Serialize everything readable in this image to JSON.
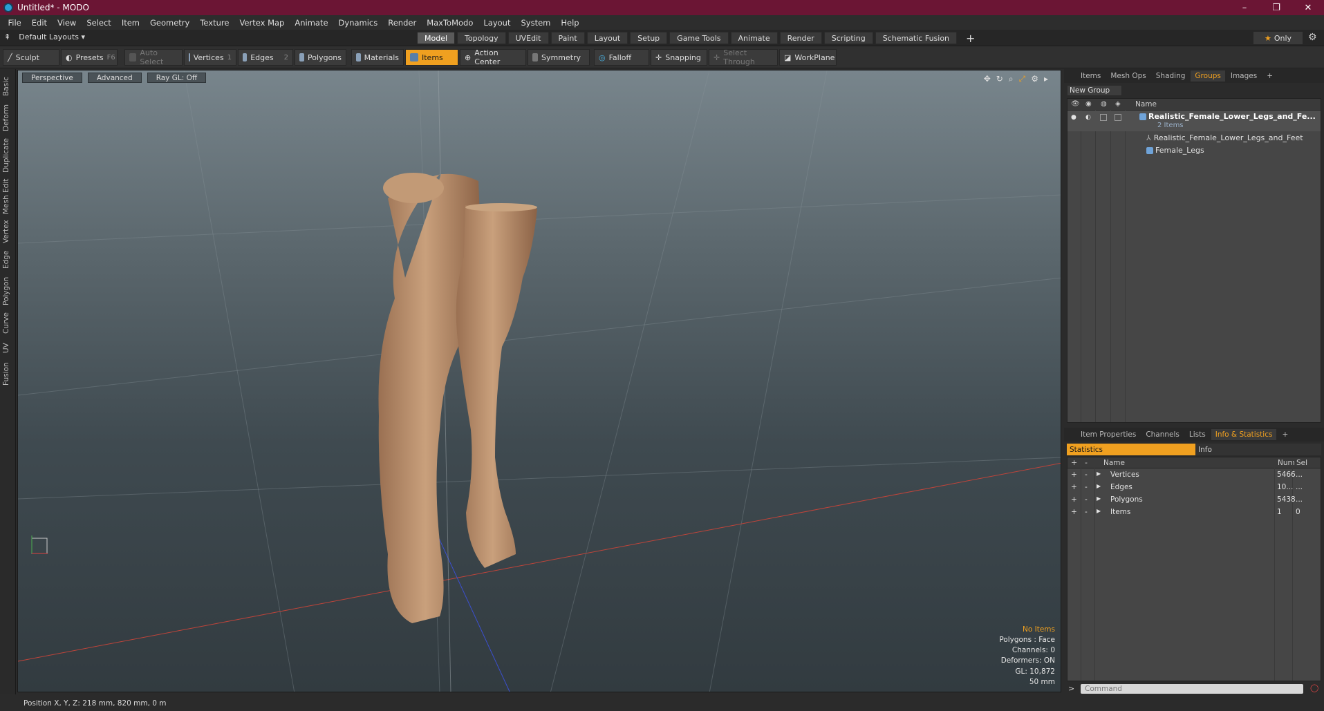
{
  "window": {
    "title": "Untitled* - MODO",
    "minimize": "–",
    "maximize": "❐",
    "close": "✕"
  },
  "menu": [
    "File",
    "Edit",
    "View",
    "Select",
    "Item",
    "Geometry",
    "Texture",
    "Vertex Map",
    "Animate",
    "Dynamics",
    "Render",
    "MaxToModo",
    "Layout",
    "System",
    "Help"
  ],
  "layout_dropdown": "Default Layouts",
  "mode_tabs": [
    "Model",
    "Topology",
    "UVEdit",
    "Paint",
    "Layout",
    "Setup",
    "Game Tools",
    "Animate",
    "Render",
    "Scripting",
    "Schematic Fusion"
  ],
  "mode_selected": "Model",
  "only_label": "Only",
  "toolbar": {
    "sculpt": "Sculpt",
    "presets": "Presets",
    "presets_key": "F6",
    "auto_select": "Auto Select",
    "vertices": "Vertices",
    "vertices_key": "1",
    "edges": "Edges",
    "edges_key": "2",
    "polygons": "Polygons",
    "materials": "Materials",
    "items": "Items",
    "action_center": "Action Center",
    "symmetry": "Symmetry",
    "falloff": "Falloff",
    "snapping": "Snapping",
    "select_through": "Select Through",
    "workplane": "WorkPlane"
  },
  "left_tabs": [
    "Basic",
    "Deform",
    "Duplicate",
    "Mesh Edit",
    "Vertex",
    "Edge",
    "Polygon",
    "Curve",
    "UV",
    "Fusion"
  ],
  "viewport": {
    "view": "Perspective",
    "advanced": "Advanced",
    "raygl": "Ray GL: Off",
    "info": {
      "items": "No Items",
      "polygons": "Polygons : Face",
      "channels": "Channels: 0",
      "deformers": "Deformers: ON",
      "gl": "GL: 10,872",
      "scale": "50 mm"
    }
  },
  "groups_panel": {
    "tabs": [
      "Items",
      "Mesh Ops",
      "Shading",
      "Groups",
      "Images"
    ],
    "selected": "Groups",
    "new_group": "New Group",
    "name_header": "Name",
    "group_name": "Realistic_Female_Lower_Legs_and_Fe...",
    "group_count": "2 Items",
    "children": [
      "Realistic_Female_Lower_Legs_and_Feet",
      "Female_Legs"
    ]
  },
  "stats_panel": {
    "tabs": [
      "Item Properties",
      "Channels",
      "Lists",
      "Info & Statistics"
    ],
    "selected": "Info & Statistics",
    "sub_tabs": [
      "Statistics",
      "Info"
    ],
    "headers": {
      "name": "Name",
      "num": "Num",
      "sel": "Sel"
    },
    "rows": [
      {
        "name": "Vertices",
        "num": "5466",
        "sel": "..."
      },
      {
        "name": "Edges",
        "num": "10...",
        "sel": "..."
      },
      {
        "name": "Polygons",
        "num": "5438",
        "sel": "..."
      },
      {
        "name": "Items",
        "num": "1",
        "sel": "0"
      }
    ]
  },
  "command_placeholder": "Command",
  "status": "Position X, Y, Z:   218 mm, 820 mm, 0 m"
}
